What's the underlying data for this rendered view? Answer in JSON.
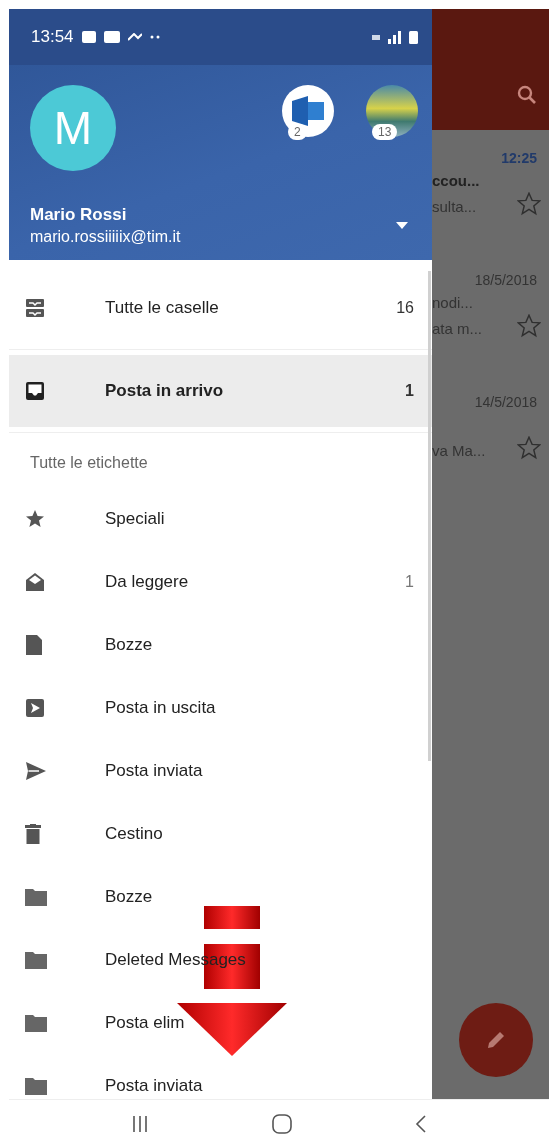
{
  "status_bar": {
    "time": "13:54"
  },
  "account": {
    "initial": "M",
    "name": "Mario Rossi",
    "email": "mario.rossiiiiix@tim.it",
    "other_accounts": [
      {
        "kind": "exchange",
        "badge": "2"
      },
      {
        "kind": "photo",
        "badge": "13"
      }
    ]
  },
  "mailboxes": [
    {
      "kind": "all-inboxes",
      "label": "Tutte le caselle",
      "count": "16",
      "selected": false
    },
    {
      "kind": "inbox",
      "label": "Posta in arrivo",
      "count": "1",
      "selected": true
    }
  ],
  "labels_title": "Tutte le etichette",
  "labels": [
    {
      "kind": "star",
      "label": "Speciali"
    },
    {
      "kind": "envelope-open",
      "label": "Da leggere",
      "count": "1"
    },
    {
      "kind": "draft",
      "label": "Bozze"
    },
    {
      "kind": "outbox",
      "label": "Posta in uscita"
    },
    {
      "kind": "send",
      "label": "Posta inviata"
    },
    {
      "kind": "trash",
      "label": "Cestino"
    },
    {
      "kind": "folder",
      "label": "Bozze"
    },
    {
      "kind": "folder",
      "label": "Deleted Messages"
    },
    {
      "kind": "folder",
      "label": "Posta elim"
    },
    {
      "kind": "folder",
      "label": "Posta inviata"
    }
  ],
  "background_messages": [
    {
      "time": "12:25",
      "unread": true,
      "subject": "ccou...",
      "snippet": "sulta..."
    },
    {
      "time": "18/5/2018",
      "unread": false,
      "subject": "nodi...",
      "snippet": "ata m..."
    },
    {
      "time": "14/5/2018",
      "unread": false,
      "snippet": "va Ma..."
    }
  ]
}
